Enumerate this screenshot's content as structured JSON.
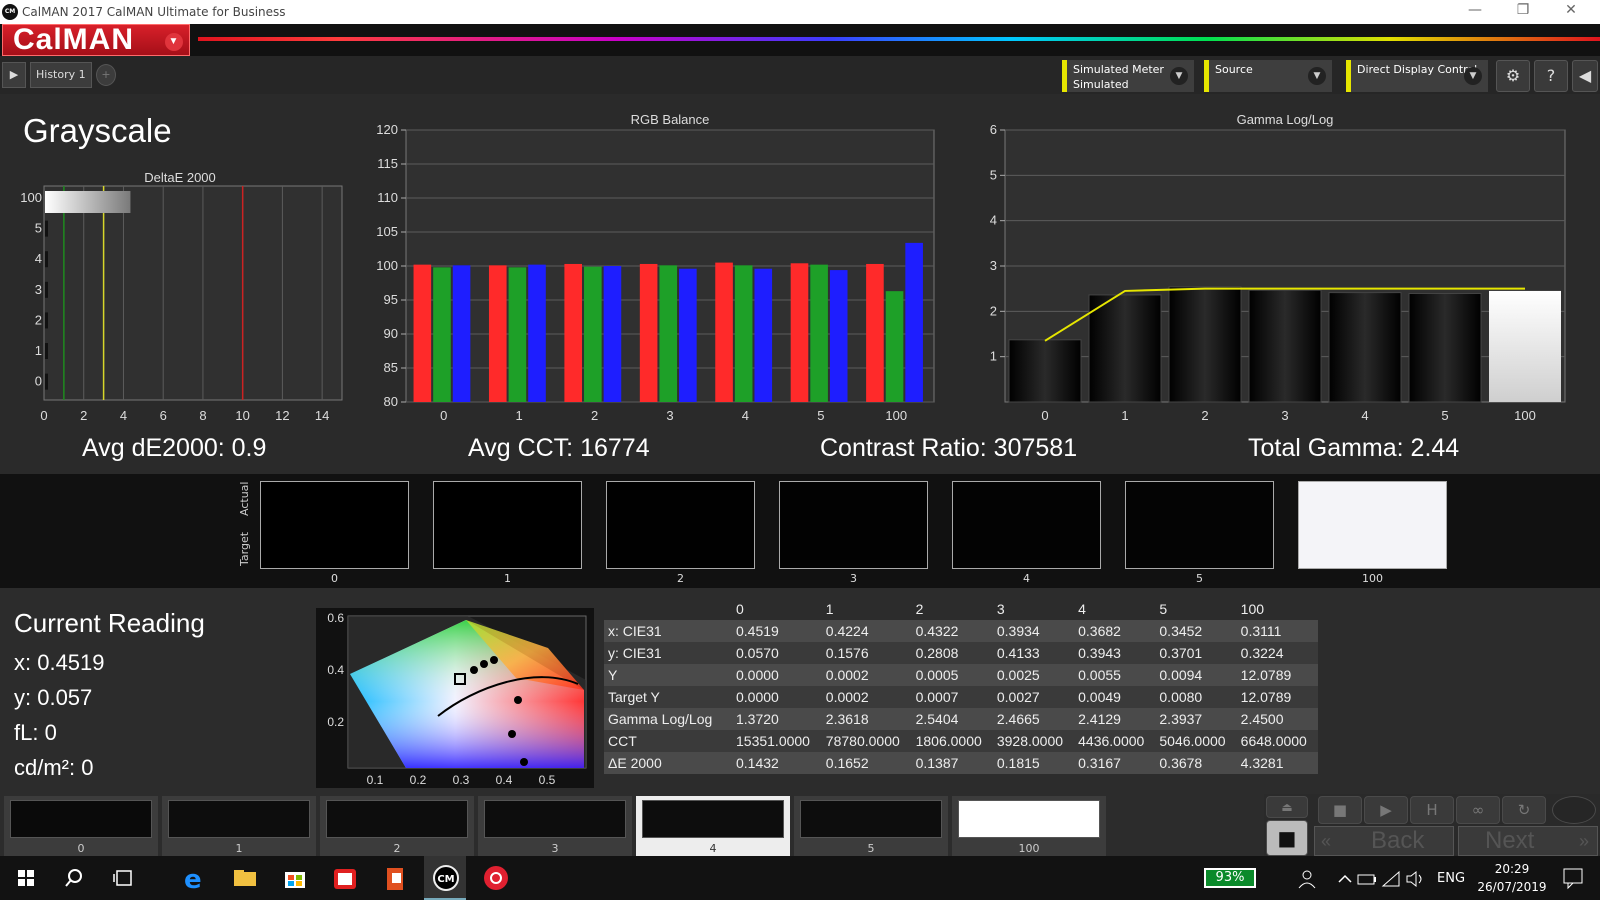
{
  "window": {
    "title": "CalMAN 2017 CalMAN Ultimate for Business",
    "icon_text": "CM",
    "minimize": "—",
    "restore": "❐",
    "close": "✕"
  },
  "brand": {
    "name": "CalMAN",
    "menu_glyph": "▼"
  },
  "toolbar": {
    "history_tab": "History 1",
    "add_tab": "+",
    "play_glyph": "▶",
    "meter_label": "Simulated Meter",
    "meter_value": "Simulated",
    "source_label": "Source",
    "ddc_label": "Direct Display Control",
    "settings_glyph": "⚙",
    "help_glyph": "?",
    "collapse_glyph": "◀",
    "arrow_glyph": "▼"
  },
  "page": {
    "title": "Grayscale"
  },
  "delta_chart": {
    "title": "DeltaE 2000",
    "ylabels": [
      "100",
      "5",
      "4",
      "3",
      "2",
      "1",
      "0"
    ],
    "xlabels": [
      "0",
      "2",
      "4",
      "6",
      "8",
      "10",
      "12",
      "14"
    ],
    "markers": {
      "green": 1,
      "yellow": 3,
      "red": 10
    },
    "colors": {
      "green": "#1f8a1f",
      "yellow": "#d6d62a",
      "red": "#cc2222"
    }
  },
  "chart_data": [
    {
      "type": "bar",
      "title": "RGB Balance",
      "categories": [
        "0",
        "1",
        "2",
        "3",
        "4",
        "5",
        "100"
      ],
      "ylim": [
        80,
        120
      ],
      "yticks": [
        80,
        85,
        90,
        95,
        100,
        105,
        110,
        115,
        120
      ],
      "series": [
        {
          "name": "R",
          "color": "#ff2a2a",
          "values": [
            100.2,
            100.1,
            100.3,
            100.3,
            100.5,
            100.4,
            100.3
          ]
        },
        {
          "name": "G",
          "color": "#1ea028",
          "values": [
            99.8,
            99.8,
            99.9,
            100.1,
            100.1,
            100.2,
            96.3
          ]
        },
        {
          "name": "B",
          "color": "#1e1eff",
          "values": [
            100.1,
            100.2,
            100.0,
            99.6,
            99.6,
            99.4,
            103.4
          ]
        }
      ]
    },
    {
      "type": "bar",
      "title": "Gamma Log/Log",
      "categories": [
        "0",
        "1",
        "2",
        "3",
        "4",
        "5",
        "100"
      ],
      "ylim": [
        0,
        6
      ],
      "yticks": [
        1,
        2,
        3,
        4,
        5,
        6
      ],
      "values": [
        1.372,
        2.3618,
        2.5404,
        2.4665,
        2.4129,
        2.3937,
        2.45
      ],
      "target_line": [
        1.35,
        2.45,
        2.5,
        2.5,
        2.5,
        2.5,
        2.5
      ],
      "line_color": "#e6e600"
    }
  ],
  "summary": {
    "avg_de": "Avg dE2000: 0.9",
    "avg_cct": "Avg CCT: 16774",
    "contrast": "Contrast Ratio: 307581",
    "total_gamma": "Total Gamma: 2.44"
  },
  "swatches": {
    "actual_label": "Actual",
    "target_label": "Target",
    "items": [
      {
        "label": "0",
        "color": "#000000"
      },
      {
        "label": "1",
        "color": "#000000"
      },
      {
        "label": "2",
        "color": "#010101"
      },
      {
        "label": "3",
        "color": "#020202"
      },
      {
        "label": "4",
        "color": "#030303"
      },
      {
        "label": "5",
        "color": "#040404"
      },
      {
        "label": "100",
        "color": "#f4f4f8"
      }
    ]
  },
  "current_reading": {
    "title": "Current Reading",
    "x": "x: 0.4519",
    "y": "y: 0.057",
    "fl": "fL: 0",
    "cdm2": "cd/m²: 0"
  },
  "cie": {
    "ylabels": [
      "0.6",
      "0.4",
      "0.2"
    ],
    "xlabels": [
      "0.1",
      "0.2",
      "0.3",
      "0.4",
      "0.5"
    ]
  },
  "table": {
    "headers": [
      "",
      "0",
      "1",
      "2",
      "3",
      "4",
      "5",
      "100"
    ],
    "rows": [
      {
        "label": "x: CIE31",
        "values": [
          "0.4519",
          "0.4224",
          "0.4322",
          "0.3934",
          "0.3682",
          "0.3452",
          "0.3111"
        ]
      },
      {
        "label": "y: CIE31",
        "values": [
          "0.0570",
          "0.1576",
          "0.2808",
          "0.4133",
          "0.3943",
          "0.3701",
          "0.3224"
        ]
      },
      {
        "label": "Y",
        "values": [
          "0.0000",
          "0.0002",
          "0.0005",
          "0.0025",
          "0.0055",
          "0.0094",
          "12.0789"
        ]
      },
      {
        "label": "Target Y",
        "values": [
          "0.0000",
          "0.0002",
          "0.0007",
          "0.0027",
          "0.0049",
          "0.0080",
          "12.0789"
        ]
      },
      {
        "label": "Gamma Log/Log",
        "values": [
          "1.3720",
          "2.3618",
          "2.5404",
          "2.4665",
          "2.4129",
          "2.3937",
          "2.4500"
        ]
      },
      {
        "label": "CCT",
        "values": [
          "15351.0000",
          "78780.0000",
          "1806.0000",
          "3928.0000",
          "4436.0000",
          "5046.0000",
          "6648.0000"
        ]
      },
      {
        "label": "ΔE 2000",
        "values": [
          "0.1432",
          "0.1652",
          "0.1387",
          "0.1815",
          "0.3167",
          "0.3678",
          "4.3281"
        ]
      }
    ]
  },
  "patches": [
    {
      "label": "0",
      "color": "#0a0a0a"
    },
    {
      "label": "1",
      "color": "#0d0d0d"
    },
    {
      "label": "2",
      "color": "#0d0d0d"
    },
    {
      "label": "3",
      "color": "#0d0d0d"
    },
    {
      "label": "4",
      "color": "#0d0d0d"
    },
    {
      "label": "5",
      "color": "#0d0d0d"
    },
    {
      "label": "100",
      "color": "#ffffff"
    }
  ],
  "controls": {
    "eject": "⏏",
    "stop_big": "■",
    "stop": "■",
    "play": "▶",
    "h": "H",
    "loop": "∞",
    "refresh": "↻",
    "back": "Back",
    "back_glyph": "«",
    "next": "Next",
    "next_glyph": "»"
  },
  "taskbar": {
    "battery": "93%",
    "lang": "ENG",
    "time": "20:29",
    "date": "26/07/2019"
  }
}
